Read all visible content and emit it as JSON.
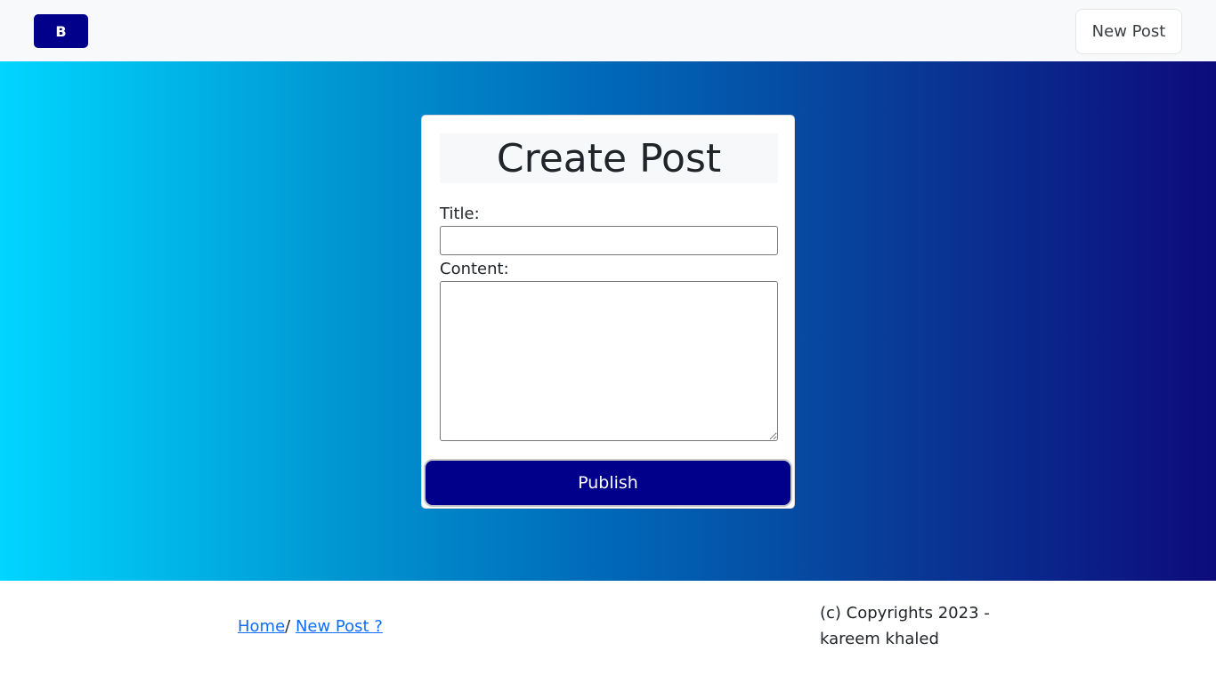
{
  "navbar": {
    "brand_label": "B",
    "new_post_label": "New Post"
  },
  "form": {
    "title": "Create Post",
    "title_label": "Title:",
    "title_value": "",
    "content_label": "Content:",
    "content_value": "",
    "submit_label": "Publish"
  },
  "footer": {
    "breadcrumb": {
      "home_label": "Home",
      "separator": "/ ",
      "current_label": "New Post ?"
    },
    "copyright_line1": "(c) Copyrights 2023 -",
    "copyright_line2": "kareem khaled"
  },
  "colors": {
    "brand": "#00008b",
    "gradient_start": "#00d6ff",
    "gradient_end": "#0d0b7c",
    "link": "#0d6efd"
  }
}
